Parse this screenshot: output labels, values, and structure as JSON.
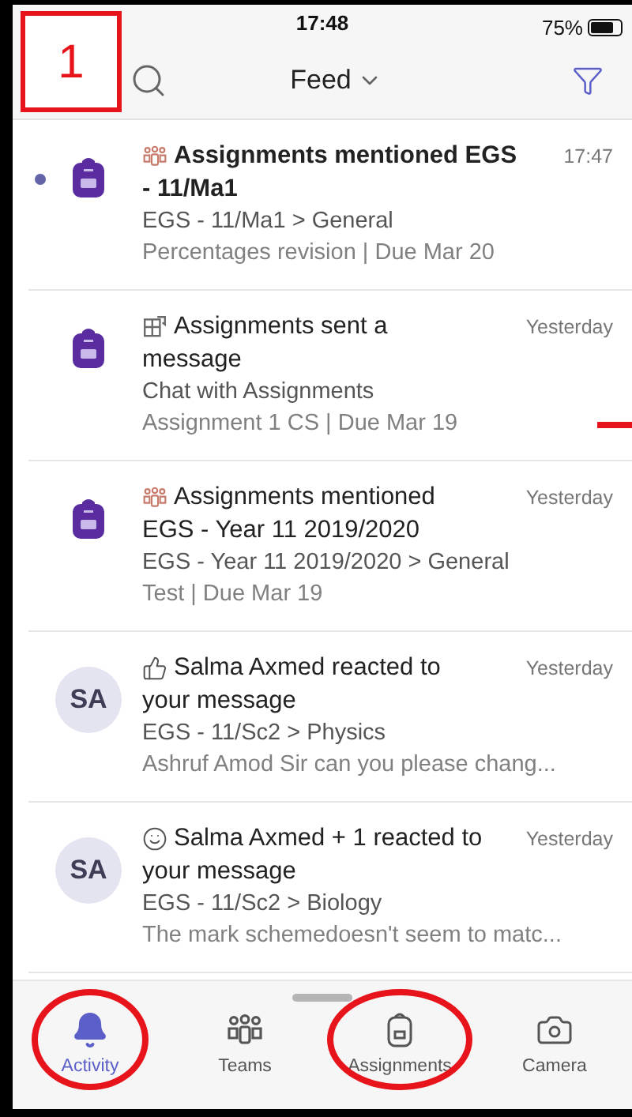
{
  "status_bar": {
    "time": "17:48",
    "battery": "75%"
  },
  "header": {
    "title": "Feed"
  },
  "feed": [
    {
      "kind": "assignment",
      "title_icon": {
        "kind": "team"
      },
      "title_lines": [
        "Assignments mentioned EGS",
        "- 11/Ma1"
      ],
      "time": "17:47",
      "unread": true,
      "line1": "EGS - 11/Ma1 > General",
      "line2": "Percentages revision | Due Mar 20"
    },
    {
      "kind": "assignment",
      "title_icon": {
        "kind": "chat"
      },
      "title_lines": [
        "Assignments sent a",
        "message"
      ],
      "time": "Yesterday",
      "unread": false,
      "line1": "Chat with Assignments",
      "line2": "Assignment 1 CS | Due Mar 19"
    },
    {
      "kind": "assignment",
      "title_icon": {
        "kind": "team"
      },
      "title_lines": [
        "Assignments mentioned",
        "EGS - Year 11 2019/2020"
      ],
      "time": "Yesterday",
      "unread": false,
      "line1": "EGS - Year 11 2019/2020 > General",
      "line2": "Test | Due Mar 19"
    },
    {
      "kind": "person",
      "initials": "SA",
      "title_icon": {
        "kind": "like"
      },
      "title_lines": [
        "Salma Axmed reacted to",
        "your message"
      ],
      "time": "Yesterday",
      "unread": false,
      "line1": "EGS - 11/Sc2 > Physics",
      "line2": "Ashruf Amod Sir can you please chang..."
    },
    {
      "kind": "person",
      "initials": "SA",
      "title_icon": {
        "kind": "emoji"
      },
      "title_lines": [
        "Salma Axmed + 1 reacted to",
        "your message"
      ],
      "time": "Yesterday",
      "unread": false,
      "line1": "EGS - 11/Sc2 > Biology",
      "line2": "The mark schemedoesn't seem to matc..."
    }
  ],
  "nav": [
    {
      "kind": "activity",
      "label": "Activity",
      "selected": true,
      "circled": true
    },
    {
      "kind": "teams",
      "label": "Teams",
      "selected": false,
      "circled": false
    },
    {
      "kind": "assignments",
      "label": "Assignments",
      "selected": false,
      "circled": true
    },
    {
      "kind": "camera",
      "label": "Camera",
      "selected": false,
      "circled": false
    }
  ],
  "annotations": [
    {
      "kind": "numbered-box",
      "label": "1"
    },
    {
      "kind": "dash"
    }
  ]
}
